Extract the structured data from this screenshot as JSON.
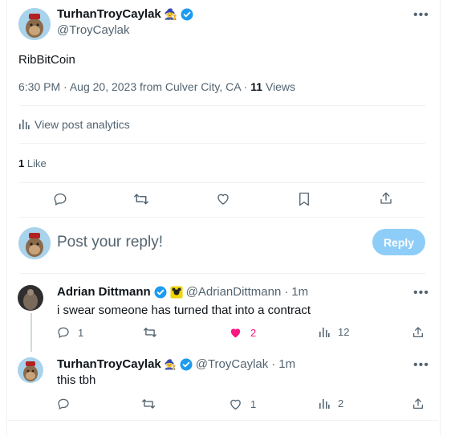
{
  "tweet": {
    "author_name": "TurhanTroyCaylak",
    "author_handle": "@TroyCaylak",
    "text": "RibBitCoin",
    "time": "6:30 PM",
    "dot": "·",
    "date_location": "Aug 20, 2023 from Culver City, CA",
    "views_count": "11",
    "views_label": "Views",
    "analytics_label": "View post analytics",
    "likes_count": "1",
    "likes_label": "Like"
  },
  "reply_box": {
    "placeholder": "Post your reply!",
    "button_label": "Reply"
  },
  "replies": [
    {
      "author_name": "Adrian Dittmann",
      "author_handle": "@AdrianDittmann",
      "age": "1m",
      "text": "i swear someone has turned that into a contract",
      "reply_count": "1",
      "retweet_count": "",
      "like_count": "2",
      "views_count": "12"
    },
    {
      "author_name": "TurhanTroyCaylak",
      "author_handle": "@TroyCaylak",
      "age": "1m",
      "text": "this tbh",
      "reply_count": "",
      "retweet_count": "",
      "like_count": "1",
      "views_count": "2"
    }
  ],
  "colors": {
    "accent": "#1d9bf0",
    "reply_button_disabled": "#8ecdf8",
    "like_active": "#f91880",
    "text_secondary": "#536471",
    "separator": "#eff3f4"
  },
  "icons": [
    "more-icon",
    "verified-icon",
    "wizard-emoji-icon",
    "analytics-icon",
    "reply-icon",
    "retweet-icon",
    "like-icon",
    "bookmark-icon",
    "share-icon",
    "views-icon",
    "affiliate-badge-icon"
  ]
}
